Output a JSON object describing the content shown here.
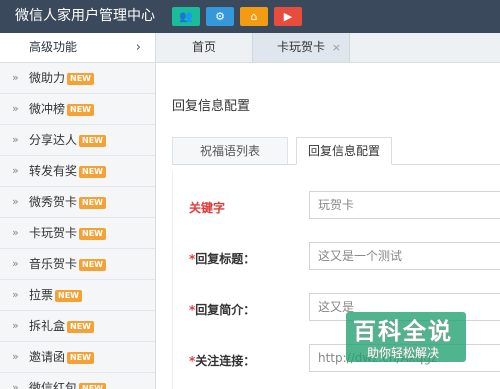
{
  "header": {
    "title": "微信人家用户管理中心",
    "buttons": [
      {
        "icon": "users-icon",
        "color": "#1abc9c",
        "glyph": "👥"
      },
      {
        "icon": "gear-icon",
        "color": "#3498db",
        "glyph": "⚙"
      },
      {
        "icon": "home-icon",
        "color": "#f39c12",
        "glyph": "⌂"
      },
      {
        "icon": "play-icon",
        "color": "#e74c3c",
        "glyph": "▶"
      }
    ]
  },
  "sidebar": {
    "header": "高级功能",
    "chevron": "›",
    "bullet": "»",
    "badge": "NEW",
    "items": [
      {
        "label": "微助力"
      },
      {
        "label": "微冲榜"
      },
      {
        "label": "分享达人"
      },
      {
        "label": "转发有奖"
      },
      {
        "label": "微秀贺卡"
      },
      {
        "label": "卡玩贺卡"
      },
      {
        "label": "音乐贺卡"
      },
      {
        "label": "拉票"
      },
      {
        "label": "拆礼盒"
      },
      {
        "label": "邀请函"
      },
      {
        "label": "微信红包"
      }
    ]
  },
  "tabs": {
    "home": "首页",
    "card": "卡玩贺卡",
    "close": "×"
  },
  "main": {
    "title": "回复信息配置",
    "subtabs": [
      "祝福语列表",
      "回复信息配置"
    ],
    "fields": [
      {
        "label": "关键字",
        "value": "玩贺卡",
        "required": false
      },
      {
        "label": "回复标题：",
        "value": "这又是一个测试",
        "required": true
      },
      {
        "label": "回复简介：",
        "value": "这又是",
        "required": true
      },
      {
        "label": "关注连接：",
        "value": "http://dwz.cn/Akqgz",
        "required": true
      }
    ],
    "required_mark": "*"
  },
  "watermark": {
    "title": "百科全说",
    "subtitle": "助你轻松解决"
  },
  "colors": {
    "topbar": "#3a4a5c",
    "badge": "#f4a236",
    "required": "#e23b3b"
  }
}
